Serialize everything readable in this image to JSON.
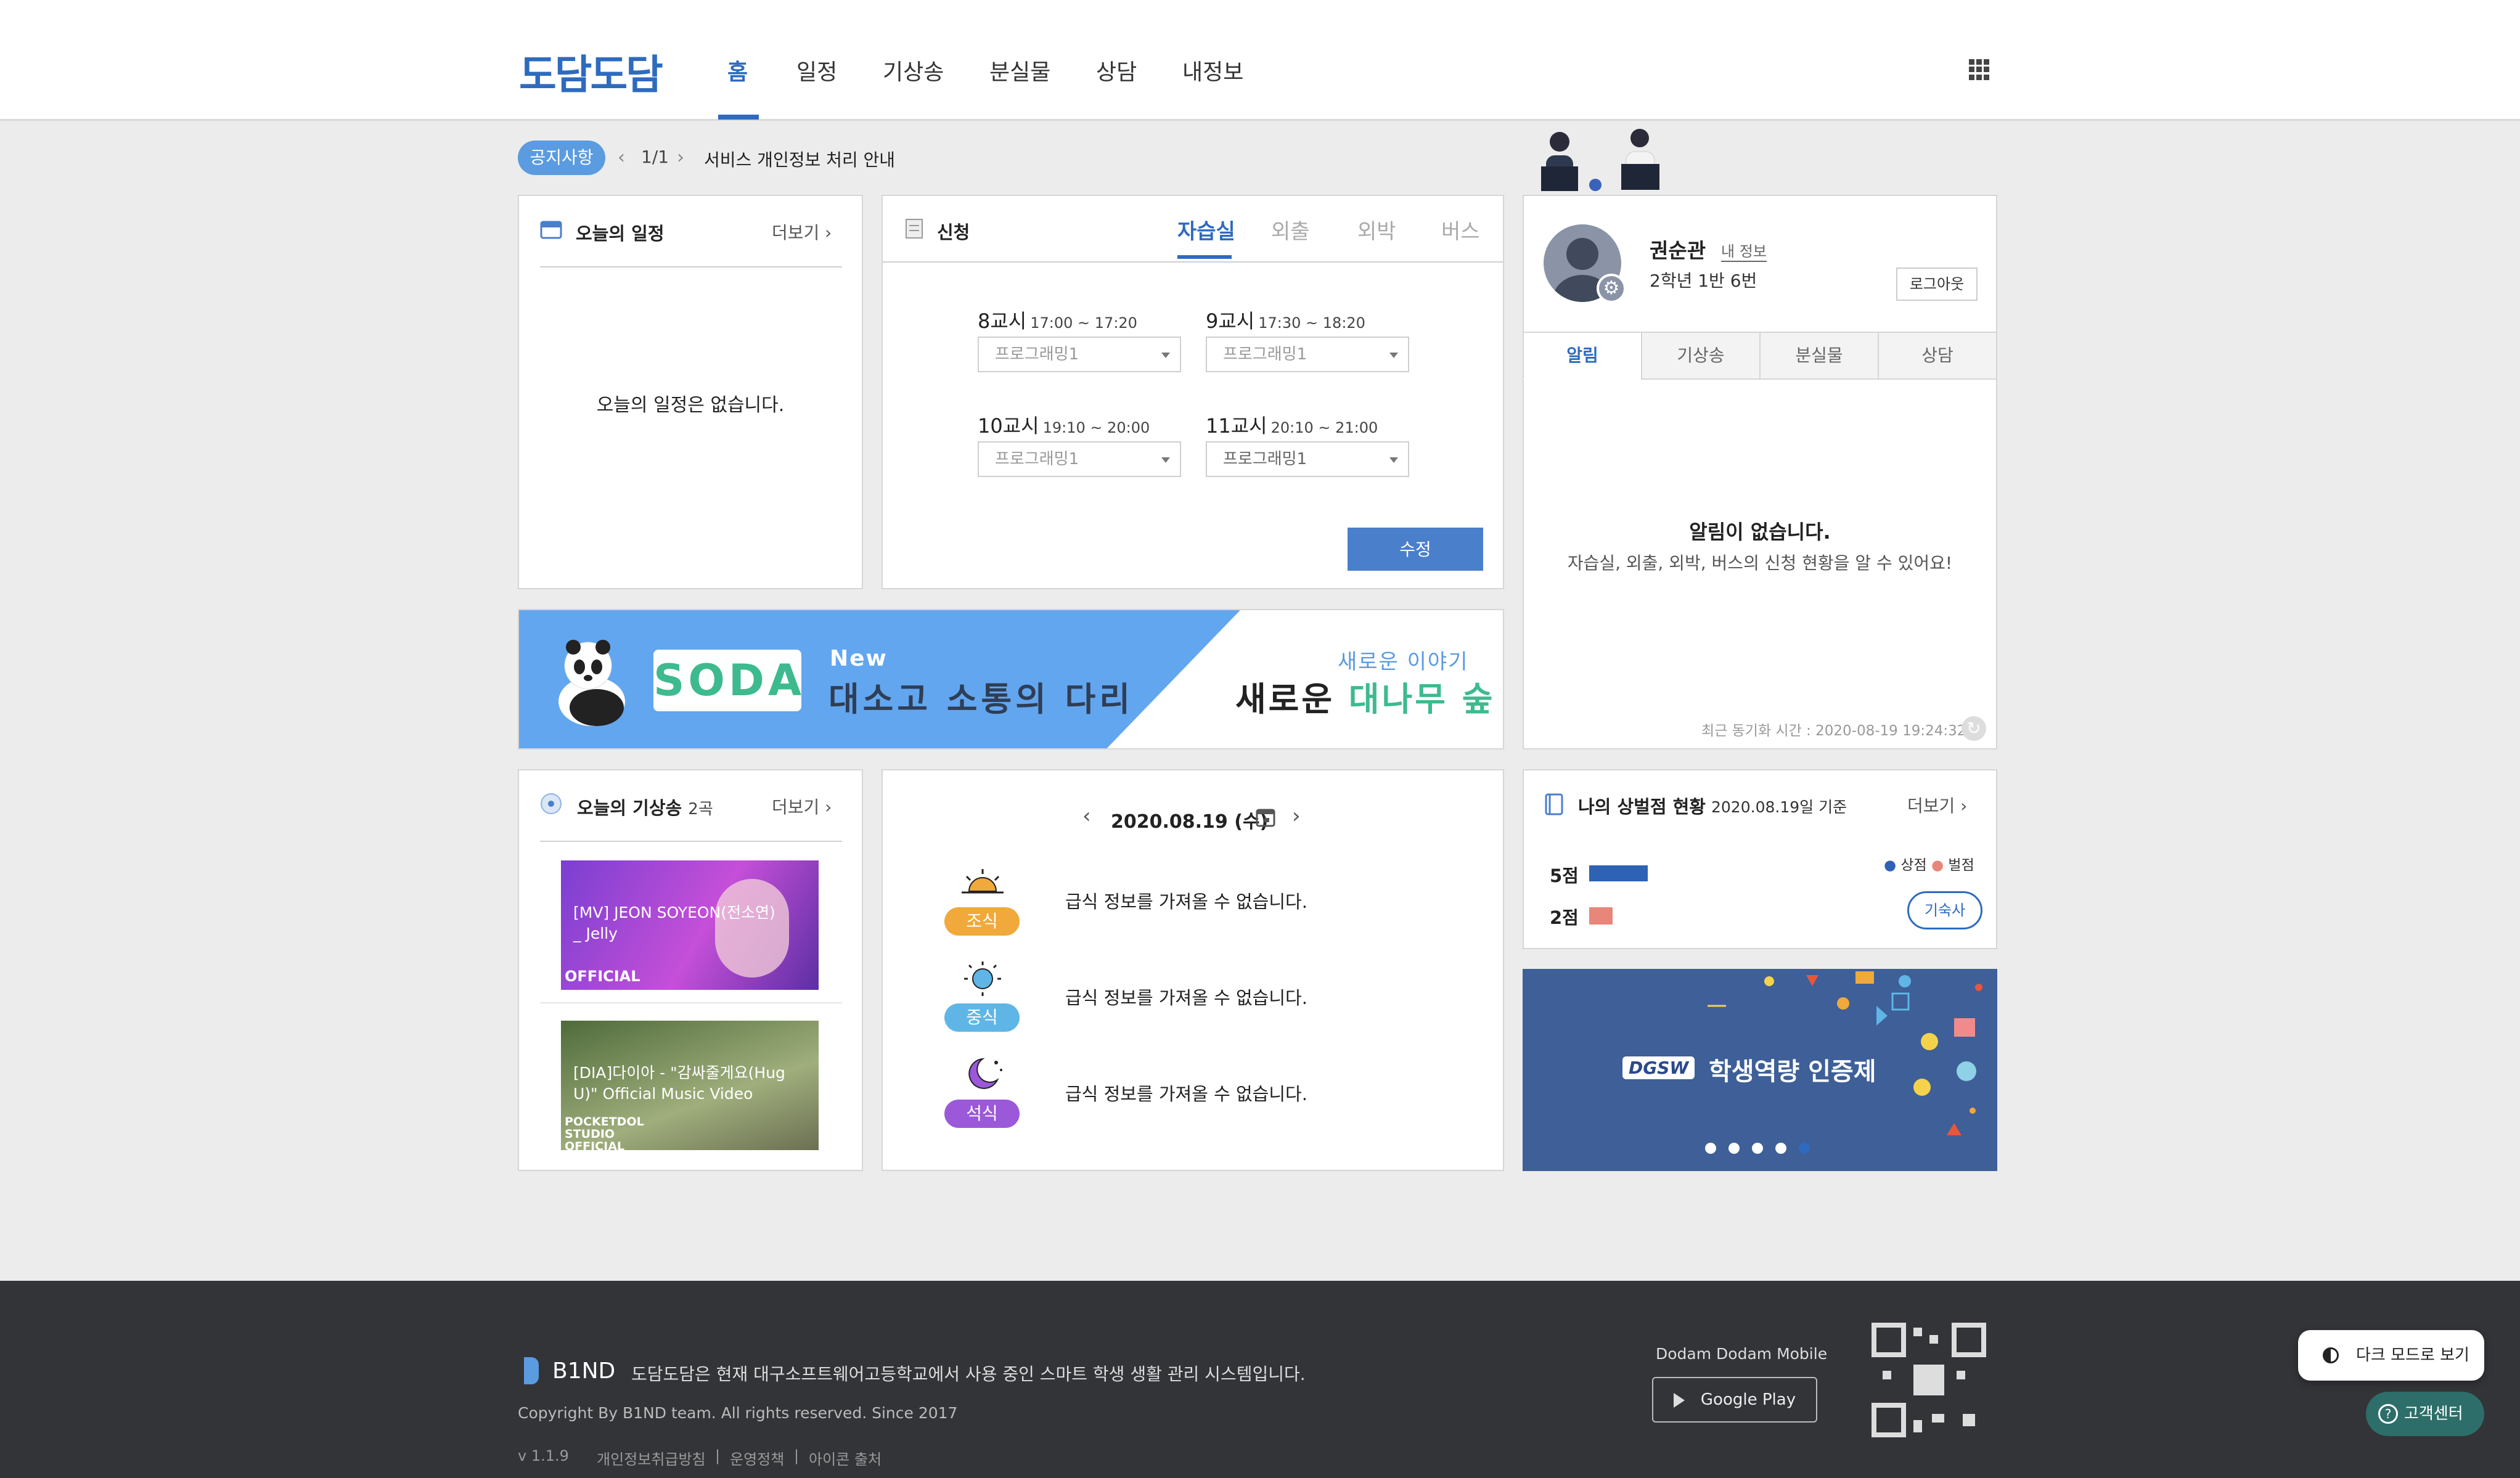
{
  "header": {
    "logo": "도담도담",
    "nav": [
      "홈",
      "일정",
      "기상송",
      "분실물",
      "상담",
      "내정보"
    ]
  },
  "notice": {
    "badge": "공지사항",
    "page": "1/1",
    "text": "서비스 개인정보 처리 안내"
  },
  "schedule": {
    "title": "오늘의 일정",
    "more": "더보기",
    "empty": "오늘의 일정은 없습니다."
  },
  "apply": {
    "title": "신청",
    "tabs": [
      "자습실",
      "외출",
      "외박",
      "버스"
    ],
    "periods": [
      {
        "label": "8교시",
        "time": "17:00 ~ 17:20",
        "value": "프로그래밍1"
      },
      {
        "label": "9교시",
        "time": "17:30 ~ 18:20",
        "value": "프로그래밍1"
      },
      {
        "label": "10교시",
        "time": "19:10 ~ 20:00",
        "value": "프로그래밍1"
      },
      {
        "label": "11교시",
        "time": "20:10 ~ 21:00",
        "value": "프로그래밍1"
      }
    ],
    "submit": "수정"
  },
  "banner": {
    "brand": "SODA",
    "new": "New",
    "slogan_main": "대소고 소통의 다리",
    "story": "새로운 이야기",
    "slogan_right_1": "새로운",
    "slogan_right_2": "대나무 숲"
  },
  "profile": {
    "name": "권순관",
    "my_info": "내 정보",
    "class": "2학년 1반 6번",
    "logout": "로그아웃",
    "tabs": [
      "알림",
      "기상송",
      "분실물",
      "상담"
    ],
    "empty_title": "알림이 없습니다.",
    "empty_desc": "자습실, 외출, 외박, 버스의 신청 현황을 알 수 있어요!",
    "sync": "최근 동기화 시간 : 2020-08-19 19:24:32"
  },
  "songs": {
    "title": "오늘의 기상송",
    "count": "2곡",
    "more": "더보기",
    "items": [
      {
        "title": "[MV] JEON SOYEON(전소연) _ Jelly",
        "mark": "OFFICIAL"
      },
      {
        "title": "[DIA]다이아 - \"감싸줄게요(Hug U)\" Official Music Video",
        "mark": "POCKETDOL STUDIO OFFICIAL"
      }
    ]
  },
  "meal": {
    "date": "2020.08.19 (수)",
    "items": [
      {
        "label": "조식",
        "text": "급식 정보를 가져올 수 없습니다.",
        "color": "#f0a93a"
      },
      {
        "label": "중식",
        "text": "급식 정보를 가져올 수 없습니다.",
        "color": "#5fb6e6"
      },
      {
        "label": "석식",
        "text": "급식 정보를 가져올 수 없습니다.",
        "color": "#9b59d9"
      }
    ]
  },
  "points": {
    "title": "나의 상벌점 현황",
    "date": "2020.08.19일 기준",
    "more": "더보기",
    "legend": [
      "상점",
      "벌점"
    ],
    "merit": "5점",
    "demerit": "2점",
    "merit_value": 5,
    "demerit_value": 2,
    "dorm_button": "기숙사",
    "colors": {
      "merit": "#2e62b4",
      "demerit": "#e8867a"
    }
  },
  "ad": {
    "brand": "DGSW",
    "text": "학생역량 인증제"
  },
  "footer": {
    "brand": "B1ND",
    "desc": "도담도담은 현재 대구소프트웨어고등학교에서 사용 중인 스마트 학생 생활 관리 시스템입니다.",
    "copyright": "Copyright By B1ND team. All rights reserved. Since 2017",
    "version": "v 1.1.9",
    "links": [
      "개인정보취급방침",
      "운영정책",
      "아이콘 출처"
    ],
    "mobile": "Dodam Dodam Mobile",
    "google_play": "Google Play",
    "dark_mode": "다크 모드로 보기",
    "help": "고객센터"
  },
  "colors": {
    "accent": "#2e6bbf",
    "footer_bg": "#333438"
  }
}
